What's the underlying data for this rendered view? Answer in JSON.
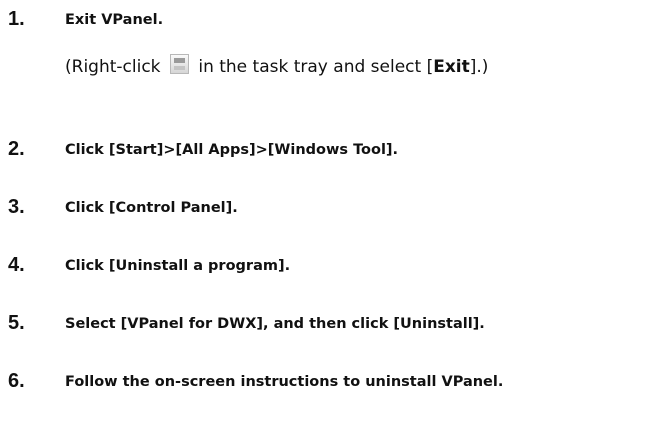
{
  "steps": [
    {
      "number": "1.",
      "text": "Exit VPanel.",
      "note": {
        "before": "(Right-click",
        "icon": "vpanel-tray-icon",
        "middle": "in the task tray and select [",
        "bold": "Exit",
        "after": "].)"
      }
    },
    {
      "number": "2.",
      "text": "Click [Start]>[All Apps]>[Windows Tool]."
    },
    {
      "number": "3.",
      "text": "Click [Control Panel]."
    },
    {
      "number": "4.",
      "text": "Click [Uninstall a program]."
    },
    {
      "number": "5.",
      "text": "Select [VPanel for DWX], and then click [Uninstall]."
    },
    {
      "number": "6.",
      "text": "Follow the on-screen instructions to uninstall VPanel."
    }
  ]
}
